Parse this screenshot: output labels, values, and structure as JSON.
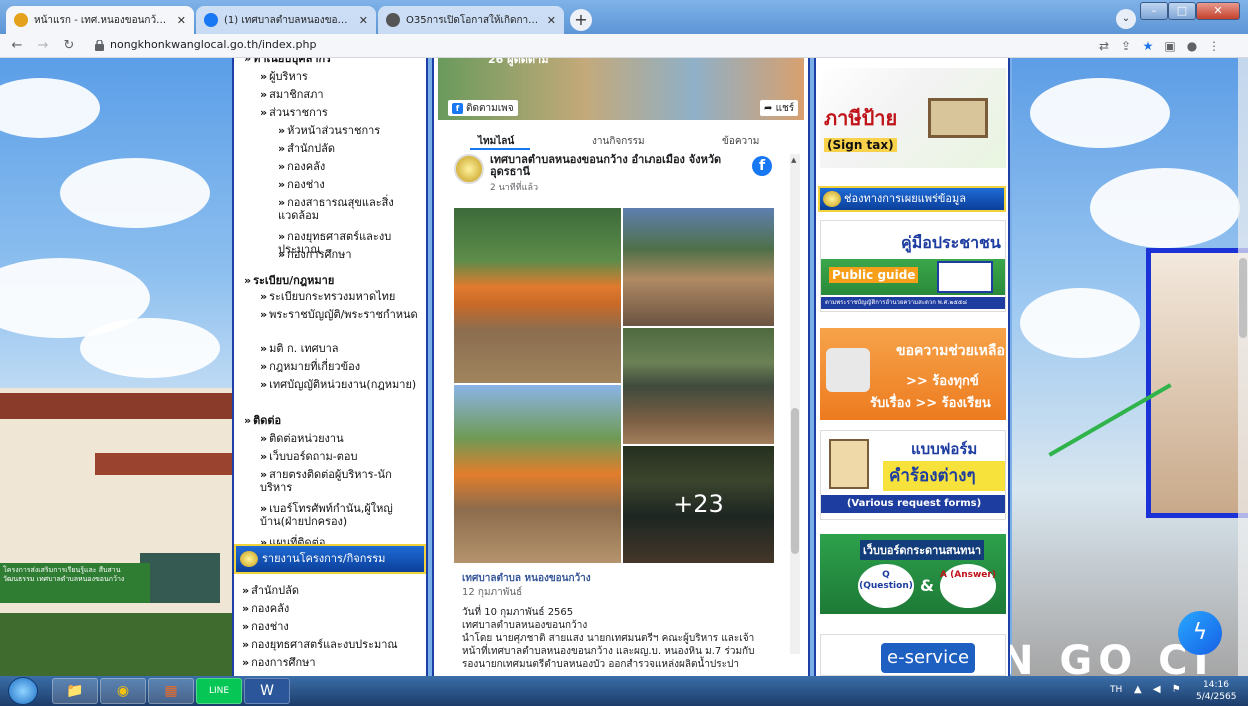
{
  "browser": {
    "tabs": [
      {
        "label": "หน้าแรก - เทศ.หนองขอนกว้าง อ.เมือง",
        "color": "#e4a11b",
        "active": true
      },
      {
        "label": "(1) เทศบาลตำบลหนองขอนกว้าง อำเภ",
        "color": "#1877f2",
        "active": false
      },
      {
        "label": "O35การเปิดโอกาสให้เกิดการมีส่วนร่วม",
        "color": "#555555",
        "active": false
      }
    ],
    "new_tab": "+",
    "url": "nongkhonkwanglocal.go.th/index.php",
    "tab_search": "⌄"
  },
  "nav": {
    "items": [
      {
        "label": "ทำเนียบบุคลากร",
        "level": 0
      },
      {
        "label": "ผู้บริหาร",
        "level": 1
      },
      {
        "label": "สมาชิกสภา",
        "level": 1
      },
      {
        "label": "ส่วนราชการ",
        "level": 1
      },
      {
        "label": "หัวหน้าส่วนราชการ",
        "level": 2
      },
      {
        "label": "สำนักปลัด",
        "level": 2
      },
      {
        "label": "กองคลัง",
        "level": 2
      },
      {
        "label": "กองช่าง",
        "level": 2
      },
      {
        "label": "กองสาธารณสุขและสิ่งแวดล้อม",
        "level": 2
      },
      {
        "label": "กองยุทธศาสตร์และงบประมาณ",
        "level": 2
      },
      {
        "label": "กองการศึกษา",
        "level": 2
      },
      {
        "label": "ระเบียบ/กฎหมาย",
        "level": 0
      },
      {
        "label": "ระเบียบกระทรวงมหาดไทย",
        "level": 1
      },
      {
        "label": "พระราชบัญญัติ/พระราชกำหนด",
        "level": 1
      },
      {
        "label": "มติ ก. เทศบาล",
        "level": 1
      },
      {
        "label": "กฎหมายที่เกี่ยวข้อง",
        "level": 1
      },
      {
        "label": "เทศบัญญัติหน่วยงาน(กฎหมาย)",
        "level": 1
      },
      {
        "label": "ติดต่อ",
        "level": 0
      },
      {
        "label": "ติดต่อหน่วยงาน",
        "level": 1
      },
      {
        "label": "เว็บบอร์ดถาม-ตอบ",
        "level": 1
      },
      {
        "label": "สายตรงติดต่อผู้บริหาร-นักบริหาร",
        "level": 1
      },
      {
        "label": "เบอร์โทรศัพท์กำนัน,ผู้ใหญ่บ้าน(ฝ่ายปกครอง)",
        "level": 1
      },
      {
        "label": "แผนที่ติดต่อ",
        "level": 1
      }
    ],
    "report_header": "รายงานโครงการ/กิจกรรม",
    "report_items": [
      "สำนักปลัด",
      "กองคลัง",
      "กองช่าง",
      "กองยุทธศาสตร์และงบประมาณ",
      "กองการศึกษา"
    ]
  },
  "facebook": {
    "cover_followers": "26 ผู้ติดตาม",
    "follow_label": "ติดตามเพจ",
    "share_label": "แชร์",
    "tabs": [
      "ไทมไลน์",
      "งานกิจกรรม",
      "ข้อความ"
    ],
    "page_name": "เทศบาลตำบลหนองขอนกว้าง อำเภอเมือง จังหวัดอุดรธานี",
    "post_time": "2 นาทีที่แล้ว",
    "more_photos": "+23",
    "post_page": "เทศบาลตำบล หนองขอนกว้าง",
    "post_date": "12 กุมภาพันธ์",
    "body": [
      "วันที่ 10 กุมภาพันธ์ 2565",
      "เทศบาลตำบลหนองขอนกว้าง",
      "นำโดย ",
      "หน้าที่เทศบาลตำบลหนองขอนกว้าง และผญ.บ. หนองหิน ม.7 ร่วมกับ",
      "รองนายกเทศมนตรีตำบลหนองบัว ออกสำรวจแหล่งผลิตน้ำประปา"
    ],
    "body_line3_suffix": "นายศุภชาติ สายแสง นายกเทศมนตรีฯ คณะผู้บริหาร และเจ้า"
  },
  "banners": {
    "sign_tax_th": "ภาษีป้าย",
    "sign_tax_en": "(Sign tax)",
    "info_header": "ช่องทางการเผยแพร่ข้อมูล",
    "guide_th": "คู่มือประชาชน",
    "guide_en": "Public guide",
    "guide_note": "ตามพระราชบัญญัติการอำนวยความสะดวก พ.ศ.๒๕๕๘",
    "help_title": "ขอความช่วยเหลือ",
    "help_line2": ">> ร้องทุกข์",
    "help_line3": "รับเรื่อง >> ร้องเรียน",
    "form_title": "แบบฟอร์ม",
    "form_main": "คำร้องต่างๆ",
    "form_en": "(Various request forms)",
    "qa_title": "เว็บบอร์ดกระดานสนทนา",
    "qa_q": "Q (Question)",
    "qa_a": "A (Answer)",
    "qa_amp": "&",
    "eservice": "e-service"
  },
  "background": {
    "left_banner": "โครงการส่งเสริมการเรียนรู้และ สืบสานวัฒนธรรม เทศบาลตำบลหนองขอนกว้าง",
    "right_text": "N GO CI"
  },
  "taskbar": {
    "apps": [
      "📁",
      "◉",
      "▦",
      "LINE",
      "W"
    ],
    "lang": "TH",
    "time": "14:16",
    "date": "5/4/2565"
  }
}
